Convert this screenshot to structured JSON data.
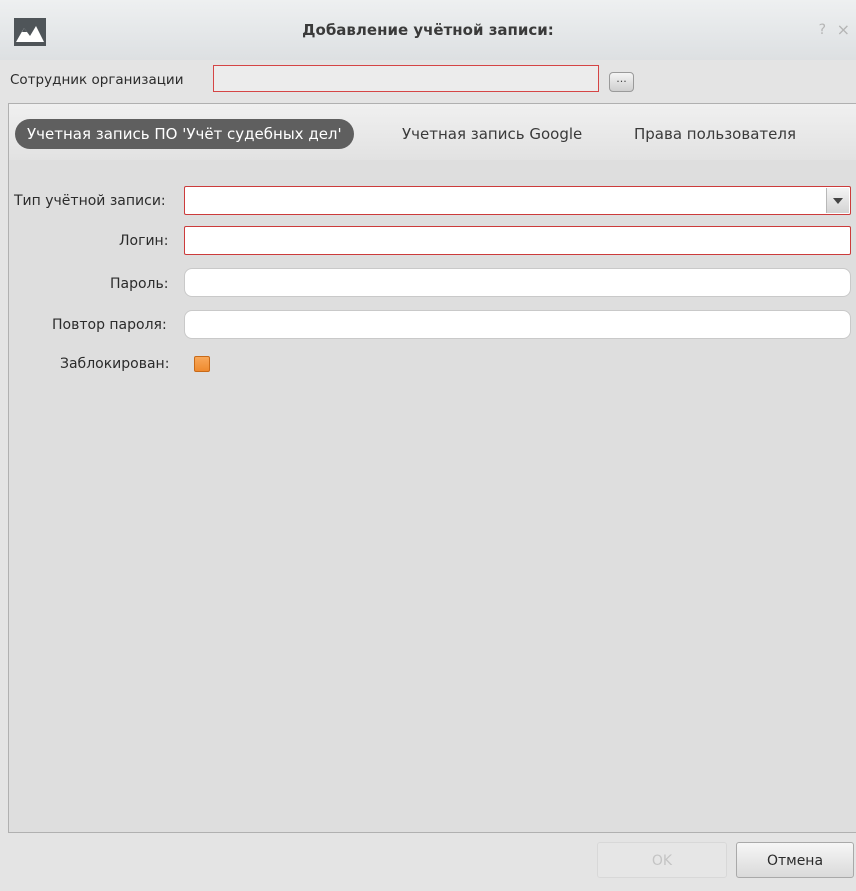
{
  "window": {
    "title": "Добавление учётной записи:",
    "help": "?",
    "close": "×"
  },
  "employee": {
    "label": "Сотрудник организации",
    "value": "",
    "browse_label": "..."
  },
  "tabs": [
    {
      "label": "Учетная запись ПО 'Учёт судебных дел'",
      "active": true
    },
    {
      "label": "Учетная запись Google",
      "active": false
    },
    {
      "label": "Права пользователя",
      "active": false
    }
  ],
  "form": {
    "account_type": {
      "label": "Тип учётной записи:",
      "value": ""
    },
    "login": {
      "label": "Логин:",
      "value": ""
    },
    "password": {
      "label": "Пароль:",
      "value": ""
    },
    "password_repeat": {
      "label": "Повтор пароля:",
      "value": ""
    },
    "blocked": {
      "label": "Заблокирован:",
      "checked": false
    }
  },
  "buttons": {
    "ok": "OK",
    "cancel": "Отмена"
  },
  "colors": {
    "error_border": "#cc3b3b",
    "active_tab": "#5f5f5f",
    "checkbox": "#ef8a2e"
  }
}
